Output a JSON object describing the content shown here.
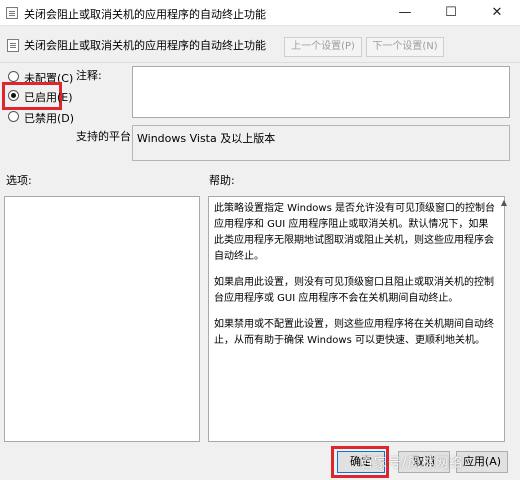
{
  "window": {
    "title": "关闭会阻止或取消关机的应用程序的自动终止功能",
    "minimize_glyph": "—",
    "maximize_glyph": "☐",
    "close_glyph": "✕"
  },
  "header": {
    "policy_title": "关闭会阻止或取消关机的应用程序的自动终止功能",
    "prev_setting": "上一个设置(P)",
    "next_setting": "下一个设置(N)"
  },
  "state_options": [
    {
      "label": "未配置(C)",
      "selected": false
    },
    {
      "label": "已启用(E)",
      "selected": true
    },
    {
      "label": "已禁用(D)",
      "selected": false
    }
  ],
  "comment": {
    "label": "注释:",
    "value": ""
  },
  "supported": {
    "label": "支持的平台:",
    "value": "Windows Vista 及以上版本"
  },
  "options": {
    "label": "选项:"
  },
  "help": {
    "label": "帮助:",
    "paragraphs": [
      "此策略设置指定 Windows 是否允许没有可见顶级窗口的控制台应用程序和 GUI 应用程序阻止或取消关机。默认情况下，如果此类应用程序无限期地试图取消或阻止关机，则这些应用程序会自动终止。",
      "如果启用此设置，则没有可见顶级窗口且阻止或取消关机的控制台应用程序或 GUI 应用程序不会在关机期间自动终止。",
      "如果禁用或不配置此设置，则这些应用程序将在关机期间自动终止，从而有助于确保 Windows 可以更快速、更顺利地关机。"
    ]
  },
  "buttons": {
    "ok": "确定",
    "cancel": "取消",
    "apply": "应用(A)"
  },
  "watermark": "百家号/风林网络",
  "colors": {
    "highlight": "#e0262d",
    "focus": "#0078d7"
  }
}
